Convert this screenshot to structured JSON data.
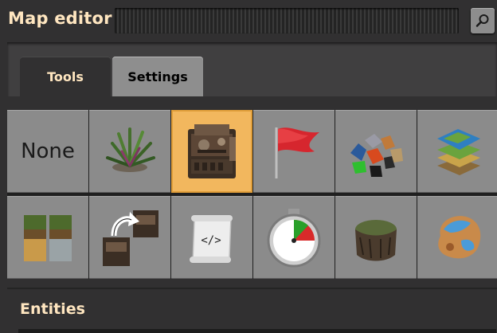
{
  "window": {
    "title": "Map editor"
  },
  "search": {
    "icon": "magnifier-icon"
  },
  "tabs": [
    {
      "label": "Tools",
      "active": true
    },
    {
      "label": "Settings",
      "active": false
    }
  ],
  "tools": [
    {
      "name": "none",
      "label": "None",
      "icon": ""
    },
    {
      "name": "decoratives",
      "icon": "plant-icon"
    },
    {
      "name": "entities",
      "icon": "machine-icon",
      "selected": true
    },
    {
      "name": "tags",
      "icon": "flag-icon"
    },
    {
      "name": "resources",
      "icon": "ore-pile-icon"
    },
    {
      "name": "tiles",
      "icon": "tile-stack-icon"
    },
    {
      "name": "cliffs-tiles",
      "icon": "terrain-blocks-icon"
    },
    {
      "name": "clone",
      "icon": "clone-icon"
    },
    {
      "name": "scripting",
      "icon": "script-scroll-icon"
    },
    {
      "name": "time",
      "icon": "stopwatch-icon"
    },
    {
      "name": "cliffs",
      "icon": "rock-stump-icon"
    },
    {
      "name": "planet",
      "icon": "asteroid-icon"
    }
  ],
  "section": {
    "title": "Entities"
  },
  "colors": {
    "accent": "#ffe6c0",
    "selected": "#f2b75e",
    "slot": "#8b8b8b",
    "background": "#313031"
  }
}
